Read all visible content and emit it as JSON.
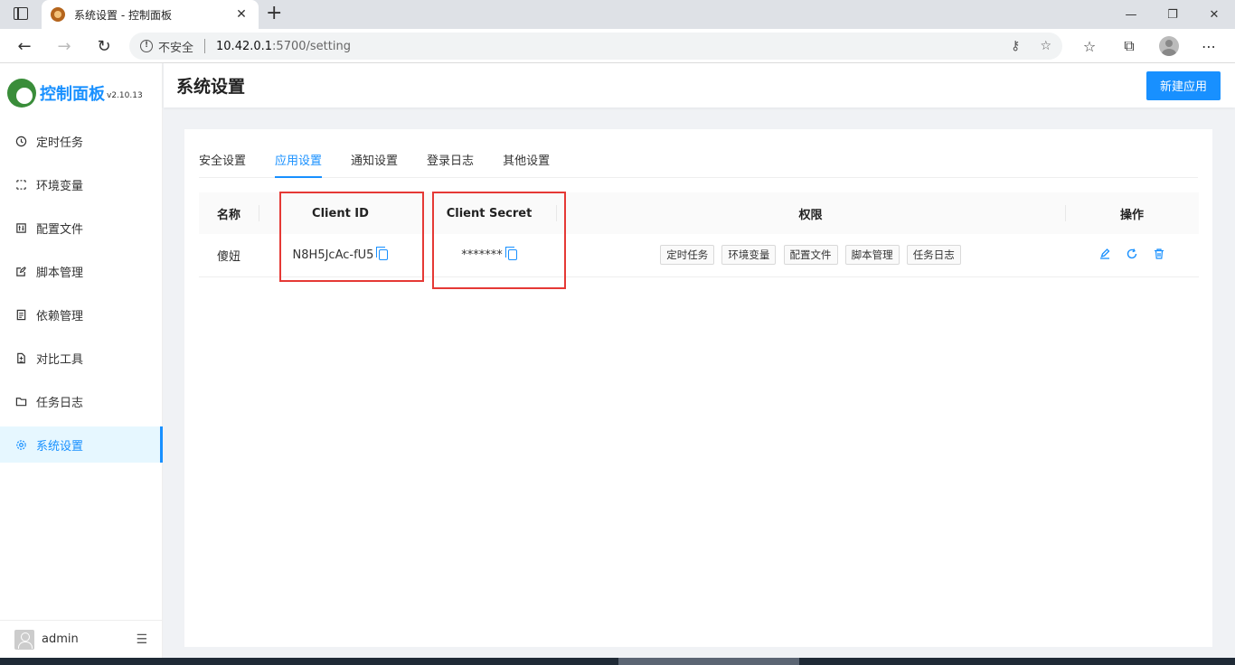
{
  "browser": {
    "tab_title": "系统设置 - 控制面板",
    "insecure_label": "不安全",
    "url_host": "10.42.0.1",
    "url_path": ":5700/setting"
  },
  "sidebar": {
    "logo_text": "控制面板",
    "version": "v2.10.13",
    "items": [
      {
        "label": "定时任务",
        "icon": "clock-icon"
      },
      {
        "label": "环境变量",
        "icon": "variable-icon"
      },
      {
        "label": "配置文件",
        "icon": "config-file-icon"
      },
      {
        "label": "脚本管理",
        "icon": "edit-icon"
      },
      {
        "label": "依赖管理",
        "icon": "package-icon"
      },
      {
        "label": "对比工具",
        "icon": "diff-icon"
      },
      {
        "label": "任务日志",
        "icon": "folder-icon"
      },
      {
        "label": "系统设置",
        "icon": "gear-icon",
        "active": true
      }
    ],
    "user": "admin"
  },
  "header": {
    "title": "系统设置",
    "new_app_button": "新建应用"
  },
  "tabs": [
    "安全设置",
    "应用设置",
    "通知设置",
    "登录日志",
    "其他设置"
  ],
  "active_tab": "应用设置",
  "table": {
    "columns": [
      "名称",
      "Client ID",
      "Client Secret",
      "权限",
      "操作"
    ],
    "rows": [
      {
        "name": "傻妞",
        "client_id": "N8H5JcAc-fU5",
        "client_secret": "*******",
        "permissions": [
          "定时任务",
          "环境变量",
          "配置文件",
          "脚本管理",
          "任务日志"
        ]
      }
    ]
  },
  "colors": {
    "accent": "#1890ff",
    "highlight_box": "#e53935"
  }
}
